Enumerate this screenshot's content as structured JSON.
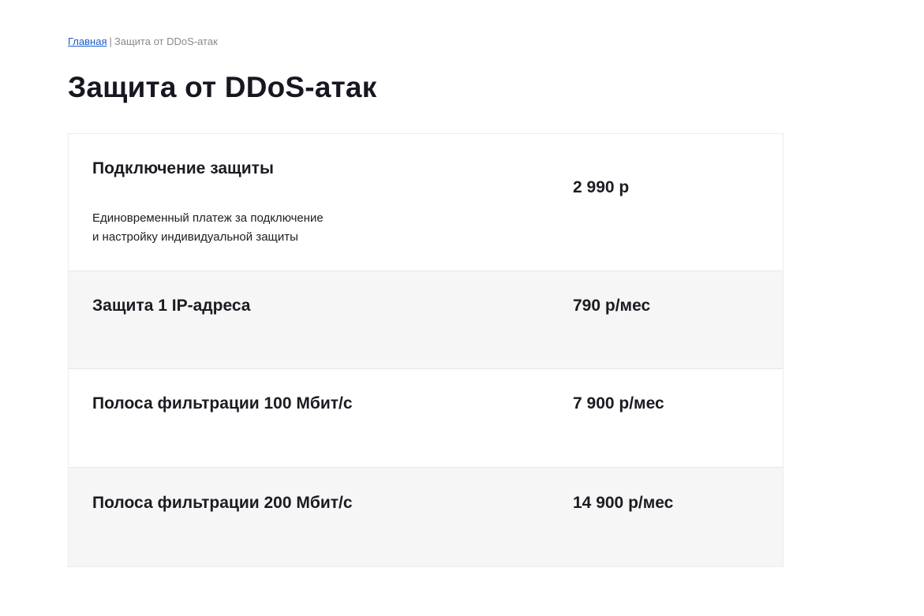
{
  "breadcrumb": {
    "home_label": "Главная",
    "separator": "|",
    "current_label": "Защита от DDoS-атак"
  },
  "page": {
    "title": "Защита от DDoS-атак"
  },
  "colors": {
    "link": "#1a5ec8",
    "row_alt_background": "#f6f6f6",
    "text": "#1b1b22"
  },
  "price_table": {
    "rows": [
      {
        "title": "Подключение защиты",
        "description_lines": [
          "Единовременный платеж за подключение",
          "и настройку индивидуальной защиты"
        ],
        "price": "2 990 р"
      },
      {
        "title": "Защита 1 IP-адреса",
        "price": "790 р/мес"
      },
      {
        "title": "Полоса фильтрации 100 Мбит/с",
        "price": "7 900 р/мес"
      },
      {
        "title": "Полоса фильтрации 200 Мбит/с",
        "price": "14 900 р/мес"
      }
    ]
  }
}
